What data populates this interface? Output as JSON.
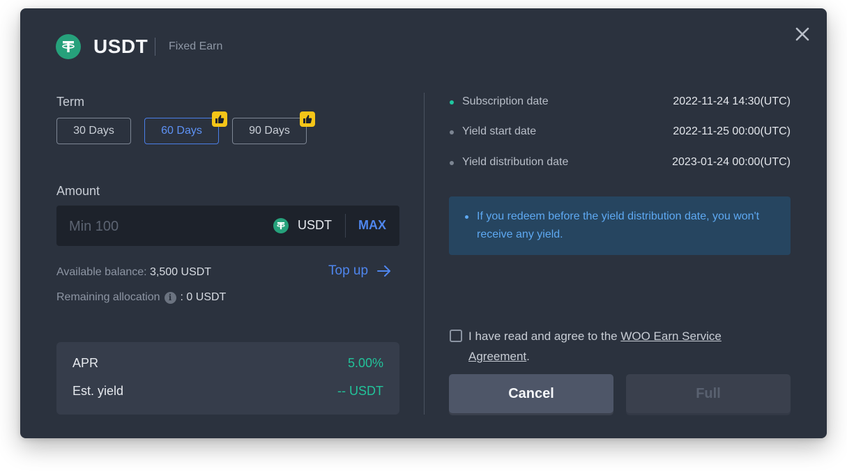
{
  "header": {
    "coin_symbol": "USDT",
    "coin_icon": "tether-icon",
    "subtitle": "Fixed Earn",
    "close_icon": "close-icon"
  },
  "term": {
    "label": "Term",
    "options": [
      {
        "label": "30 Days",
        "selected": false,
        "recommended": false
      },
      {
        "label": "60 Days",
        "selected": true,
        "recommended": true
      },
      {
        "label": "90 Days",
        "selected": false,
        "recommended": true
      }
    ]
  },
  "amount": {
    "label": "Amount",
    "placeholder": "Min 100",
    "value": "",
    "currency": "USDT",
    "max_label": "MAX"
  },
  "balance": {
    "available_label": "Available balance:",
    "available_value": "3,500 USDT",
    "topup_label": "Top up",
    "remaining_label": "Remaining allocation",
    "remaining_value": ": 0 USDT"
  },
  "yield_card": {
    "apr_label": "APR",
    "apr_value": "5.00%",
    "est_label": "Est. yield",
    "est_value": "-- USDT"
  },
  "timeline": [
    {
      "label": "Subscription date",
      "value": "2022-11-24 14:30(UTC)",
      "active": true
    },
    {
      "label": "Yield start date",
      "value": "2022-11-25 00:00(UTC)",
      "active": false
    },
    {
      "label": "Yield distribution date",
      "value": "2023-01-24 00:00(UTC)",
      "active": false
    }
  ],
  "notice": {
    "text": "If you redeem before the yield distribution date, you won't receive any yield."
  },
  "agreement": {
    "prefix": "I have read and agree to the ",
    "link_text": "WOO Earn Service Agreement",
    "suffix": ".",
    "checked": false
  },
  "actions": {
    "cancel_label": "Cancel",
    "full_label": "Full"
  },
  "colors": {
    "background": "#2b323e",
    "accent_blue": "#4b7fe8",
    "accent_green": "#22c39a",
    "recommend_badge": "#f5c518",
    "tether": "#26a17b"
  }
}
